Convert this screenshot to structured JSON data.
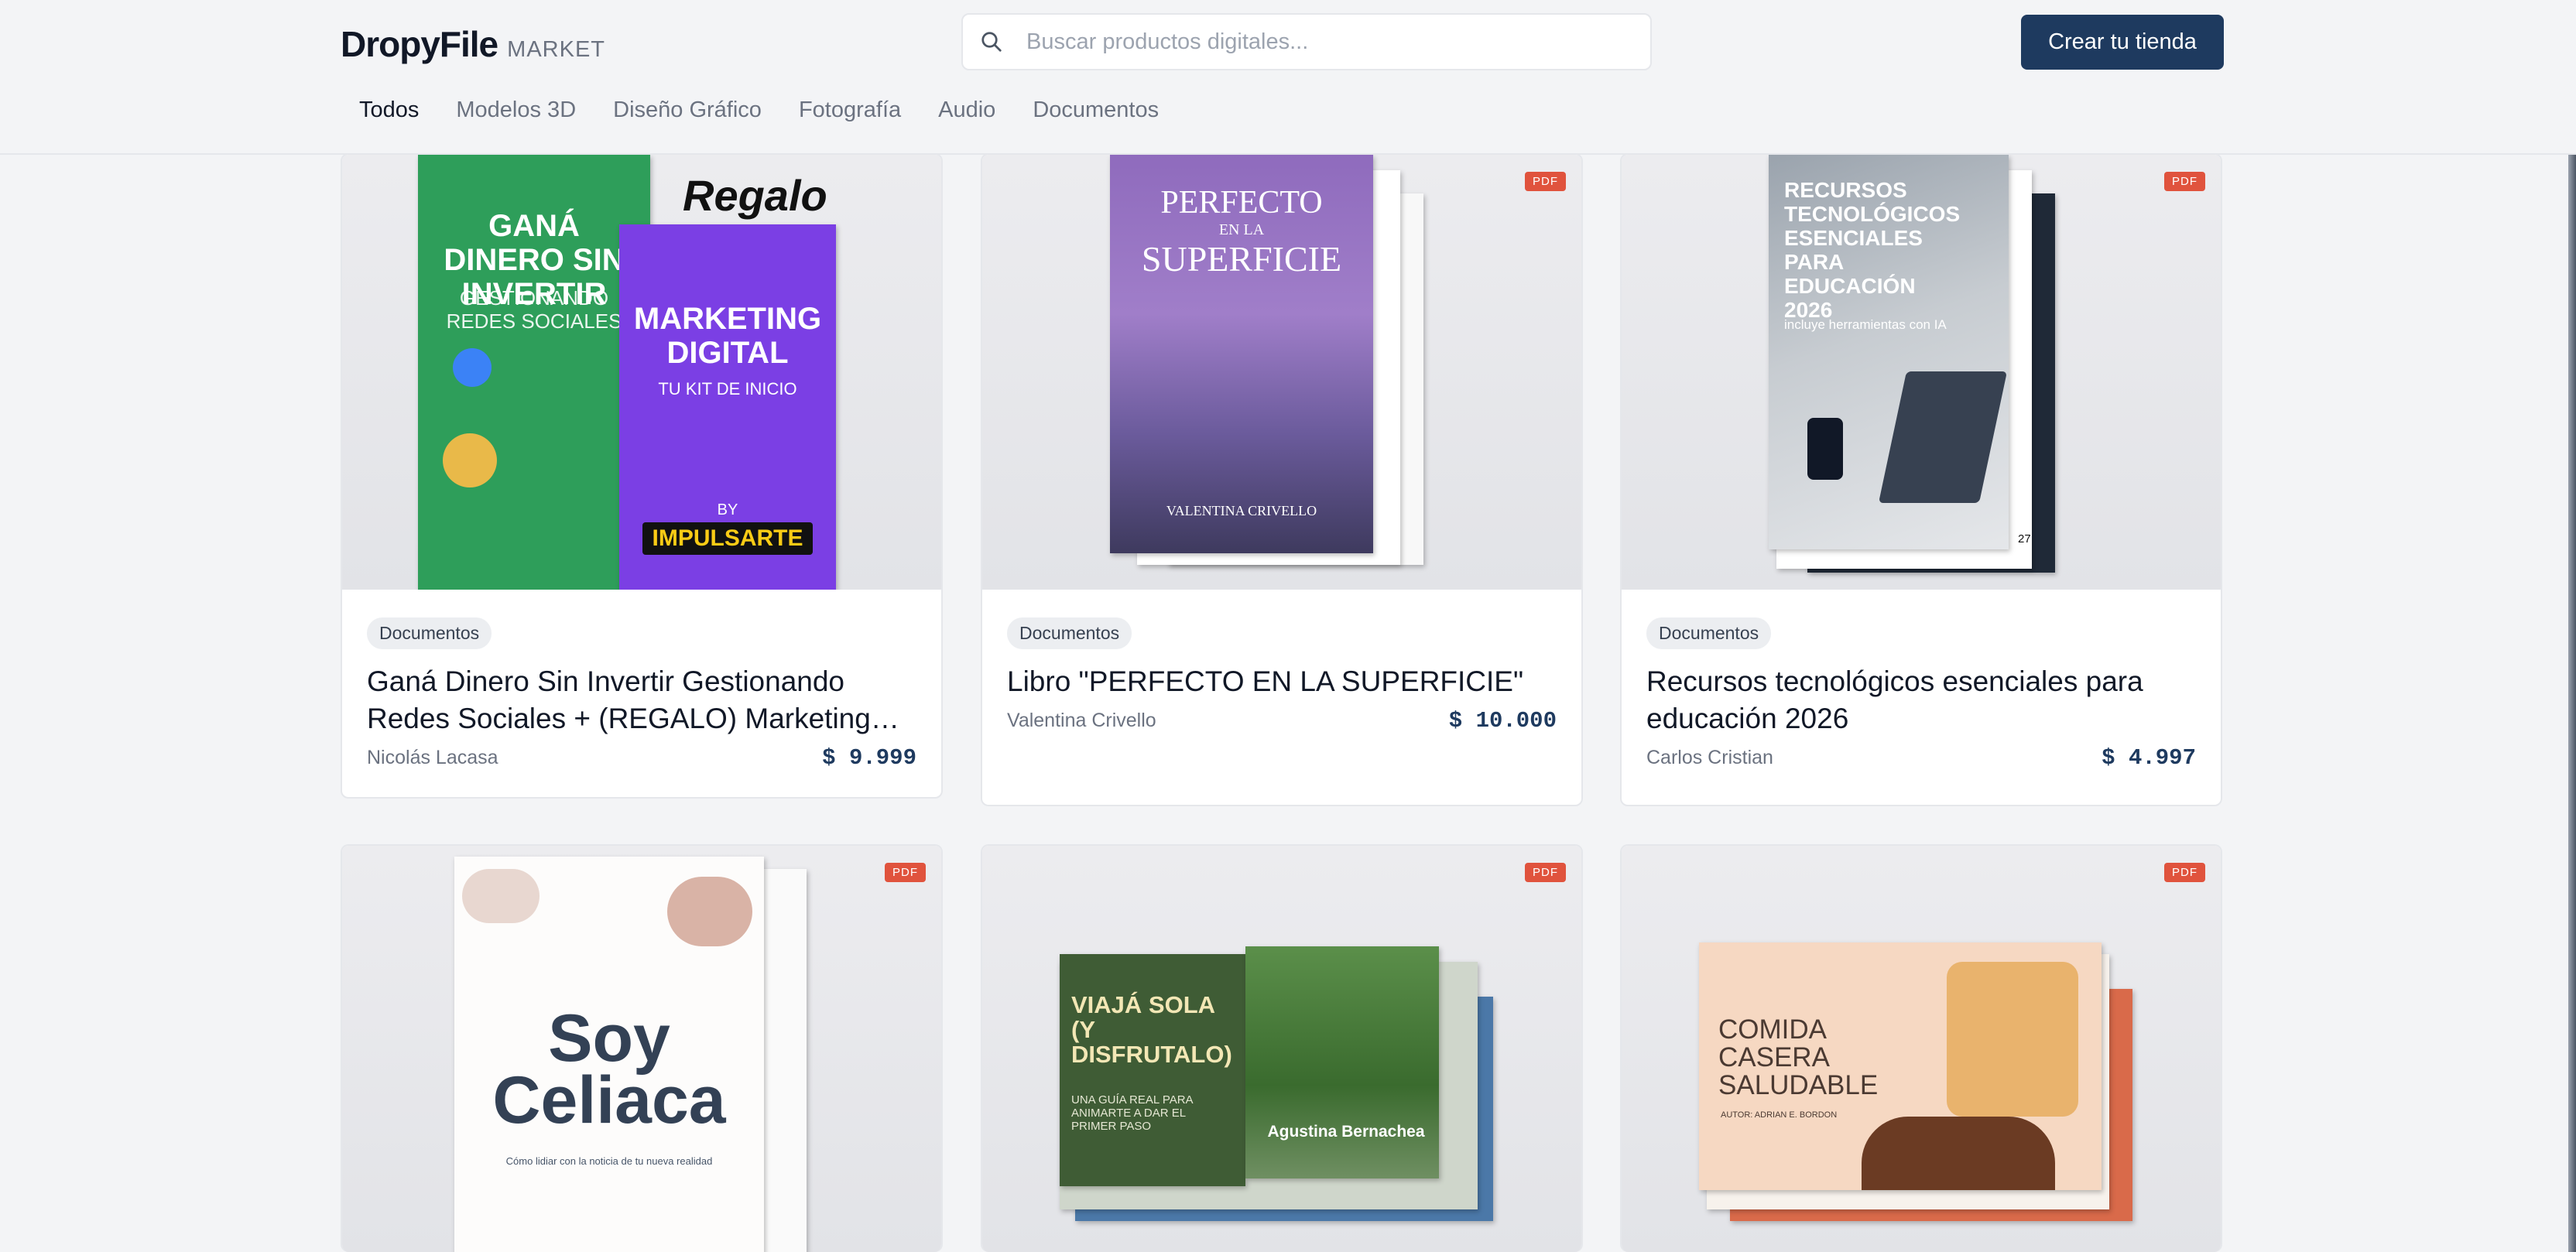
{
  "header": {
    "logo_main": "DropyFile",
    "logo_sub": "MARKET",
    "search_placeholder": "Buscar productos digitales...",
    "cta_label": "Crear tu tienda"
  },
  "nav": [
    "Todos",
    "Modelos 3D",
    "Diseño Gráfico",
    "Fotografía",
    "Audio",
    "Documentos"
  ],
  "nav_active": "Todos",
  "products": [
    {
      "category": "Documentos",
      "title": "Ganá Dinero Sin Invertir Gestionando Redes Sociales + (REGALO) Marketing Digital",
      "author": "Nicolás Lacasa",
      "price": "$ 9.999",
      "badge": "",
      "cover": {
        "main_text": "GANÁ DINERO SIN INVERTIR",
        "sub_text": "GESTIONANDO REDES SOCIALES",
        "gift_text": "Regalo",
        "second_title": "MARKETING DIGITAL",
        "second_sub": "TU KIT DE INICIO",
        "brand_by": "BY",
        "brand": "IMPULSARTE"
      }
    },
    {
      "category": "Documentos",
      "title": "Libro \"PERFECTO EN LA SUPERFICIE\"",
      "author": "Valentina Crivello",
      "price": "$ 10.000",
      "badge": "PDF",
      "cover": {
        "title_line1": "PERFECTO",
        "title_line2": "EN LA",
        "title_line3": "SUPERFICIE",
        "author": "VALENTINA CRIVELLO"
      }
    },
    {
      "category": "Documentos",
      "title": "Recursos tecnológicos esenciales para educación 2026",
      "author": "Carlos Cristian",
      "price": "$ 4.997",
      "badge": "PDF",
      "cover": {
        "title": "RECURSOS TECNOLÓGICOS ESENCIALES PARA EDUCACIÓN 2026",
        "subtitle": "incluye herramientas con IA",
        "page": "27"
      }
    },
    {
      "category": "",
      "title": "",
      "author": "",
      "price": "",
      "badge": "PDF",
      "cover": {
        "title_line1": "Soy",
        "title_line2": "Celiaca",
        "subtitle": "Cómo lidiar con la noticia de tu nueva realidad"
      }
    },
    {
      "category": "",
      "title": "",
      "author": "",
      "price": "",
      "badge": "PDF",
      "cover": {
        "title": "VIAJÁ SOLA (Y DISFRUTALO)",
        "subtitle": "UNA GUÍA REAL PARA ANIMARTE A DAR EL PRIMER PASO",
        "author": "Agustina Bernachea"
      }
    },
    {
      "category": "",
      "title": "",
      "author": "",
      "price": "",
      "badge": "PDF",
      "cover": {
        "title": "COMIDA CASERA SALUDABLE",
        "author": "AUTOR: ADRIAN E. BORDON"
      }
    }
  ],
  "colors": {
    "page_bg": "#f3f4f6",
    "primary": "#1e3a5f",
    "badge": "#e0533d"
  }
}
